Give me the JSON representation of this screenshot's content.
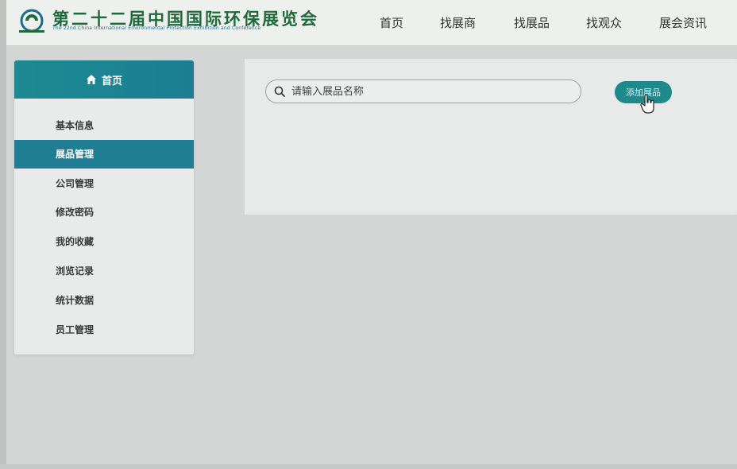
{
  "header": {
    "logo_title": "第二十二届中国国际环保展览会",
    "logo_subtitle": "The 22nd China International Environmental Protection Exhibition and Conference",
    "nav": [
      {
        "label": "首页"
      },
      {
        "label": "找展商"
      },
      {
        "label": "找展品"
      },
      {
        "label": "找观众"
      },
      {
        "label": "展会资讯"
      }
    ]
  },
  "sidebar": {
    "home_label": "首页",
    "items": [
      {
        "label": "基本信息"
      },
      {
        "label": "展品管理",
        "active": true
      },
      {
        "label": "公司管理"
      },
      {
        "label": "修改密码"
      },
      {
        "label": "我的收藏"
      },
      {
        "label": "浏览记录"
      },
      {
        "label": "统计数据"
      },
      {
        "label": "员工管理"
      }
    ]
  },
  "main": {
    "search": {
      "placeholder": "请输入展品名称",
      "value": ""
    },
    "add_button_label": "添加展品"
  },
  "colors": {
    "accent": "#1f7e93",
    "button": "#1e8a8c",
    "logo_text": "#1f6a3a"
  },
  "icons": [
    "logo-icon",
    "home-icon",
    "search-icon",
    "hand-cursor-icon"
  ]
}
